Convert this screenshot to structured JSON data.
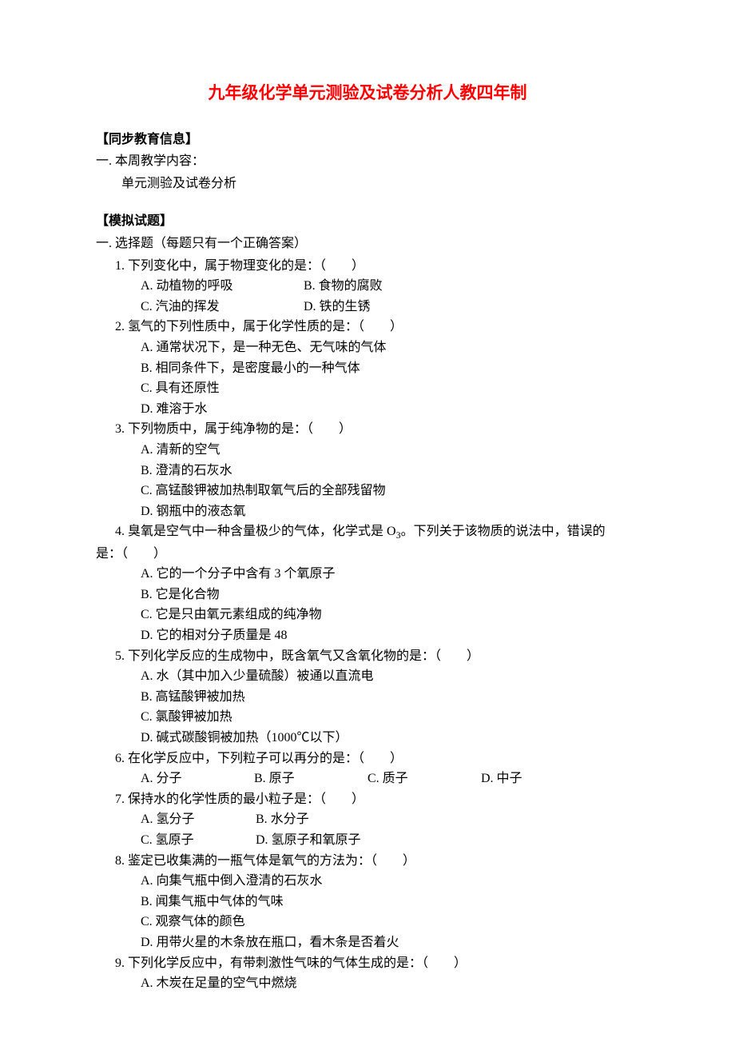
{
  "title": "九年级化学单元测验及试卷分析人教四年制",
  "s1": {
    "header": "【同步教育信息】",
    "line1": "一. 本周教学内容：",
    "line2": "单元测验及试卷分析"
  },
  "s2": {
    "header": "【模拟试题】",
    "intro": "一.  选择题（每题只有一个正确答案）"
  },
  "q1": {
    "stem": "1. 下列变化中，属于物理变化的是：（　　）",
    "a": "A. 动植物的呼吸",
    "b": "B. 食物的腐败",
    "c": "C. 汽油的挥发",
    "d": "D. 铁的生锈"
  },
  "q2": {
    "stem": "2. 氢气的下列性质中，属于化学性质的是：（　　）",
    "a": "A. 通常状况下，是一种无色、无气味的气体",
    "b": "B. 相同条件下，是密度最小的一种气体",
    "c": "C. 具有还原性",
    "d": "D. 难溶于水"
  },
  "q3": {
    "stem": "3. 下列物质中，属于纯净物的是：（　　）",
    "a": "A. 清新的空气",
    "b": "B. 澄清的石灰水",
    "c": "C. 高锰酸钾被加热制取氧气后的全部残留物",
    "d": "D. 钢瓶中的液态氧"
  },
  "q4": {
    "stem1": "4. 臭氧是空气中一种含量极少的气体，化学式是 O",
    "sub": "3",
    "stem1b": "。下列关于该物质的说法中，错误的",
    "stem2": "是：（　　）",
    "a": "A. 它的一个分子中含有 3 个氧原子",
    "b": "B. 它是化合物",
    "c": "C. 它是只由氧元素组成的纯净物",
    "d": "D. 它的相对分子质量是 48"
  },
  "q5": {
    "stem": "5. 下列化学反应的生成物中，既含氧气又含氧化物的是：（　　）",
    "a": "A. 水（其中加入少量硫酸）被通以直流电",
    "b": "B. 高锰酸钾被加热",
    "c": "C. 氯酸钾被加热",
    "d": "D. 碱式碳酸铜被加热（1000℃以下）"
  },
  "q6": {
    "stem": "6. 在化学反应中，下列粒子可以再分的是：（　　）",
    "a": "A. 分子",
    "b": "B. 原子",
    "c": "C. 质子",
    "d": "D. 中子"
  },
  "q7": {
    "stem": "7. 保持水的化学性质的最小粒子是：（　　）",
    "a": "A. 氢分子",
    "b": "B. 水分子",
    "c": "C. 氢原子",
    "d": "D. 氢原子和氧原子"
  },
  "q8": {
    "stem": "8. 鉴定已收集满的一瓶气体是氧气的方法为：（　　）",
    "a": "A. 向集气瓶中倒入澄清的石灰水",
    "b": "B. 闻集气瓶中气体的气味",
    "c": "C. 观察气体的颜色",
    "d": "D. 用带火星的木条放在瓶口，看木条是否着火"
  },
  "q9": {
    "stem": "9. 下列化学反应中，有带刺激性气味的气体生成的是：（　　）",
    "a": "A. 木炭在足量的空气中燃烧"
  }
}
